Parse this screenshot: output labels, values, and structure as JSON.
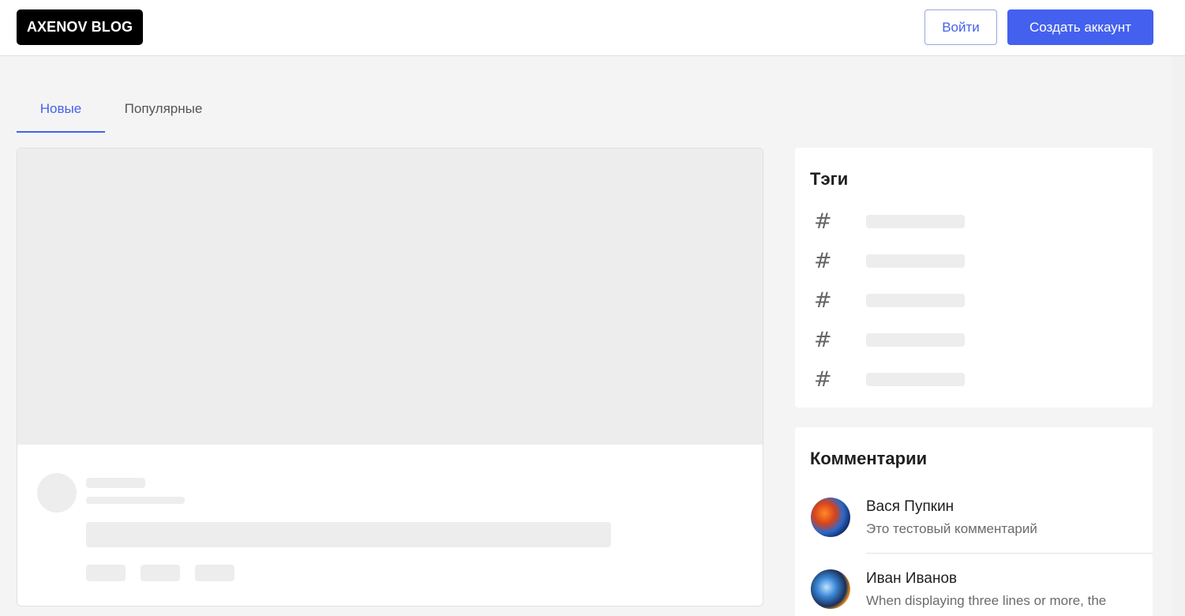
{
  "header": {
    "logo": "AXENOV BLOG",
    "login_label": "Войти",
    "signup_label": "Создать аккаунт"
  },
  "tabs": [
    {
      "label": "Новые",
      "active": true
    },
    {
      "label": "Популярные",
      "active": false
    }
  ],
  "tags_card": {
    "title": "Тэги",
    "icon": "hash-icon",
    "items": [
      "#",
      "#",
      "#",
      "#",
      "#"
    ]
  },
  "comments_card": {
    "title": "Комментарии",
    "items": [
      {
        "author": "Вася Пупкин",
        "text": "Это тестовый комментарий"
      },
      {
        "author": "Иван Иванов",
        "text": "When displaying three lines or more, the"
      }
    ]
  },
  "colors": {
    "accent": "#4361ee",
    "logo_bg": "#000000",
    "page_bg": "#f4f4f4",
    "skeleton": "#ededed"
  }
}
